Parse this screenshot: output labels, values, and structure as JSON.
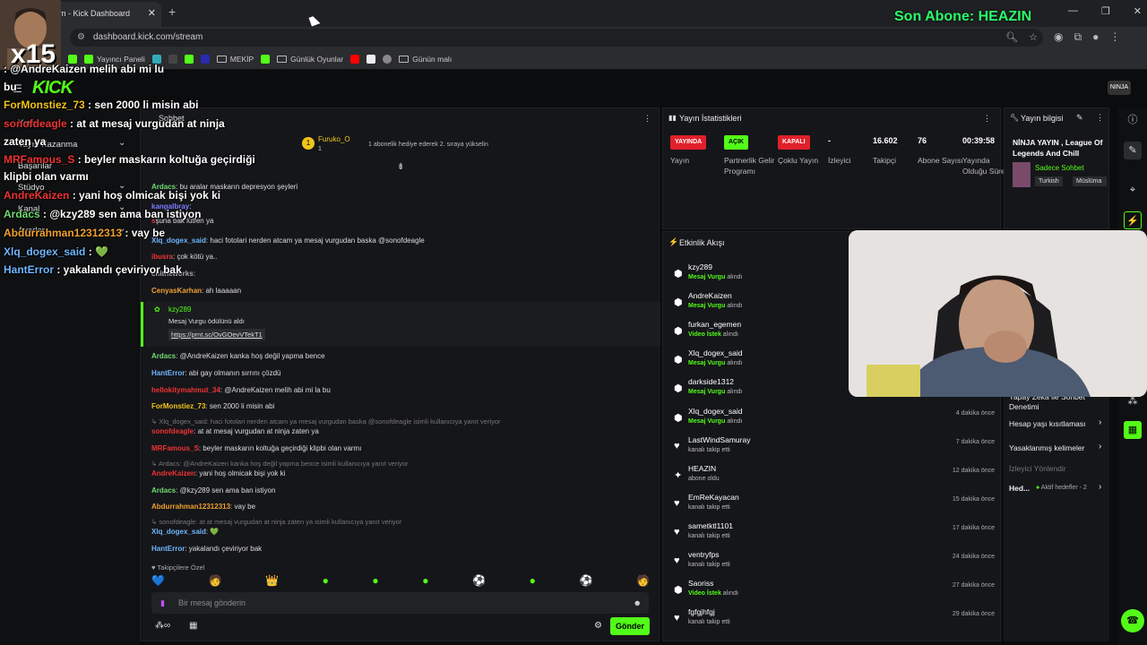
{
  "browser": {
    "tab_title": "m - Kick Dashboard",
    "url": "dashboard.kick.com/stream",
    "bookmarks": [
      "Yayıncı Paneli",
      "MEKİP",
      "Günlük Oyunlar",
      "Günün malı"
    ]
  },
  "overlay": {
    "multiplier": "x15",
    "sub_alert": "Son Abone: HEAZIN",
    "chat": [
      {
        "user": "",
        "text": ": @AndreKaizen melih abi mi lu",
        "color": "#e33"
      },
      {
        "user": "bu",
        "text": "",
        "color": "#fff"
      },
      {
        "user": "ForMonstiez_73",
        "text": " : sen 2000 li misin abi",
        "color": "#f0c419"
      },
      {
        "user": "sonofdeagle",
        "text": " : at at mesaj vurgudan at ninja",
        "color": "#e33"
      },
      {
        "user": "zaten ya",
        "text": "",
        "color": "#fff"
      },
      {
        "user": "MRFamous_S",
        "text": " : beyler maskarın koltuğa geçirdiği",
        "color": "#e33"
      },
      {
        "user": "klipbi olan varmı",
        "text": "",
        "color": "#fff"
      },
      {
        "user": "AndreKaizen",
        "text": " : yani hoş olmicak bişi yok ki",
        "color": "#e33"
      },
      {
        "user": "Ardacs",
        "text": " : @kzy289 sen ama ban istiyon",
        "color": "#6fdc6f"
      },
      {
        "user": "Abdurrahman12312313",
        "text": " : vay be",
        "color": "#f0a030"
      },
      {
        "user": "Xlq_dogex_said",
        "text": " : 💚",
        "color": "#6fb5ff"
      },
      {
        "user": "HantError",
        "text": " : yakalandı çeviriyor bak",
        "color": "#6fb5ff"
      }
    ]
  },
  "sidebar": {
    "items": [
      "Yayın",
      "Yayın Kazanma",
      "Başarılar",
      "Stüdyo",
      "Kanal",
      "Ayarlar"
    ]
  },
  "chat": {
    "header": "Sohbet",
    "pinned_user": "Furuko_O",
    "pinned_count": "1",
    "pinned_text": "1 abonelik hediye ederek 2. sıraya yükselin",
    "messages": [
      {
        "user": "Ardacs",
        "text": ": bu aralar maskarın depresyon şeyleri",
        "color": "#6fdc6f"
      },
      {
        "user": "kangalbray",
        "text": ":",
        "color": "#7b7bff"
      },
      {
        "user": "s",
        "text": "şuna bak lütfen ya",
        "color": "#e33"
      },
      {
        "user": "Xlq_dogex_said",
        "text": ": haci fotolari nerden atcam ya mesaj vurgudan baska @sonofdeagle",
        "color": "#6fb5ff"
      },
      {
        "user": "ibusra",
        "text": ": çok kötü ya..",
        "color": "#e33"
      },
      {
        "user": "chitheworks",
        "text": ":",
        "color": "#aaa"
      },
      {
        "user": "CenyasKarhan",
        "text": ": ah laaaaan",
        "color": "#f0a030"
      }
    ],
    "award": {
      "user": "kzy289",
      "text": "Mesaj Vurgu ödülünü aldı",
      "link": "https://prnt.sc/OvGOevVTekT1"
    },
    "messages2": [
      {
        "user": "Ardacs",
        "text": ": @AndreKaizen kanka hoş değil yapma bence",
        "color": "#6fdc6f"
      },
      {
        "user": "HantError",
        "text": ": abi gay olmanın sırrını çözdü",
        "color": "#6fb5ff"
      },
      {
        "user": "hellokitymahmut_34",
        "text": ": @AndreKaizen melih abi mi la bu",
        "color": "#e33"
      },
      {
        "user": "ForMonstiez_73",
        "text": ": sen 2000 li misin abi",
        "color": "#f0c419"
      }
    ],
    "reply1": "↳ Xlq_dogex_said: haci fotolari nerden atcam ya mesaj vurgudan baska @sonofdeagle isimli kullanıcıya yanıt veriyor",
    "messages3": [
      {
        "user": "sonofdeagle",
        "text": ": at at mesaj vurgudan at ninja zaten ya",
        "color": "#e33"
      },
      {
        "user": "MRFamous_S",
        "text": ": beyler maskarın koltuğa geçirdiği klipbi olan varmı",
        "color": "#e33"
      }
    ],
    "reply2": "↳ Ardacs: @AndreKaizen kanka hoş değil yapma bence isimli kullanıcıya yanıt veriyor",
    "messages4": [
      {
        "user": "AndreKaizen",
        "text": ": yani hoş olmicak bişi yok ki",
        "color": "#e33"
      },
      {
        "user": "Ardacs",
        "text": ": @kzy289 sen ama ban istiyon",
        "color": "#6fdc6f"
      },
      {
        "user": "Abdurrahman12312313",
        "text": ": vay be",
        "color": "#f0a030"
      }
    ],
    "reply3": "↳ sonofdeagle: at at mesaj vurgudan at ninja zaten ya isimli kullanıcıya yanıt veriyor",
    "messages5": [
      {
        "user": "Xlq_dogex_said",
        "text": ": 💚",
        "color": "#6fb5ff"
      },
      {
        "user": "HantError",
        "text": ": yakalandı çeviriyor bak",
        "color": "#6fb5ff"
      }
    ],
    "emotes_label": "♥ Takipçilere Özel",
    "input_placeholder": "Bir mesaj gönderin",
    "send_label": "Gönder"
  },
  "stats": {
    "title": "Yayın İstatistikleri",
    "cols": [
      {
        "value": "YAYINDA",
        "label": "Yayın",
        "badge": "red"
      },
      {
        "value": "AÇIK",
        "label": "Partnerlik Gelir Programı",
        "badge": "green"
      },
      {
        "value": "KAPALI",
        "label": "Çoklu Yayın",
        "badge": "red"
      },
      {
        "value": "-",
        "label": "İzleyici",
        "badge": ""
      },
      {
        "value": "16.602",
        "label": "Takipçi",
        "badge": ""
      },
      {
        "value": "76",
        "label": "Abone Sayısı",
        "badge": ""
      },
      {
        "value": "00:39:58",
        "label": "Yayında Olduğu Süre",
        "badge": ""
      }
    ]
  },
  "info": {
    "title": "Yayın bilgisi",
    "stream_title": "NİNJA YAYIN , League Of Legends And Chill",
    "category": "Sadece Sohbet",
    "tags": [
      "Turkish",
      "Müslüma"
    ]
  },
  "activity": {
    "title": "Etkinlik Akışı",
    "items": [
      {
        "user": "kzy289",
        "type": "Mesaj Vurgu",
        "suffix": " alındı",
        "time": "",
        "icon": "gift"
      },
      {
        "user": "AndreKaizen",
        "type": "Mesaj Vurgu",
        "suffix": " alındı",
        "time": "",
        "icon": "gift"
      },
      {
        "user": "furkan_egemen",
        "type": "Video İstek",
        "suffix": " alındı",
        "time": "",
        "icon": "gift"
      },
      {
        "user": "Xlq_dogex_said",
        "type": "Mesaj Vurgu",
        "suffix": " alındı",
        "time": "",
        "icon": "gift"
      },
      {
        "user": "darkside1312",
        "type": "Mesaj Vurgu",
        "suffix": " alındı",
        "time": "",
        "icon": "gift"
      },
      {
        "user": "Xlq_dogex_said",
        "type": "Mesaj Vurgu",
        "suffix": " alındı",
        "time": "4 dakika önce",
        "icon": "gift"
      },
      {
        "user": "LastWindSamuray",
        "type": "",
        "suffix": "kanalı takip etti",
        "time": "7 dakika önce",
        "icon": "heart"
      },
      {
        "user": "HEAZIN",
        "type": "",
        "suffix": "abone oldu",
        "time": "12 dakika önce",
        "icon": "star"
      },
      {
        "user": "EmReKayacan",
        "type": "",
        "suffix": "kanalı takip etti",
        "time": "15 dakika önce",
        "icon": "heart"
      },
      {
        "user": "sametktl1101",
        "type": "",
        "suffix": "kanalı takip etti",
        "time": "17 dakika önce",
        "icon": "heart"
      },
      {
        "user": "ventryfps",
        "type": "",
        "suffix": "kanalı takip etti",
        "time": "24 dakika önce",
        "icon": "heart"
      },
      {
        "user": "Saoriss",
        "type": "Video İstek",
        "suffix": " alındı",
        "time": "27 dakika önce",
        "icon": "gift"
      },
      {
        "user": "fgfgjhfgj",
        "type": "",
        "suffix": "kanalı takip etti",
        "time": "29 dakika önce",
        "icon": "heart"
      }
    ]
  },
  "settings": {
    "items": [
      "Yapay Zeka ile Sohbet Denetimi",
      "Hesap yaşı kısıtlaması",
      "Yasaklanmış kelimeler",
      "İzleyici Yönlendir",
      "Hed..."
    ],
    "goal_label": "Aktif hedefler - 2"
  },
  "colors": {
    "brand": "#53fc18",
    "panel": "#15161a",
    "live": "#e0202a"
  }
}
